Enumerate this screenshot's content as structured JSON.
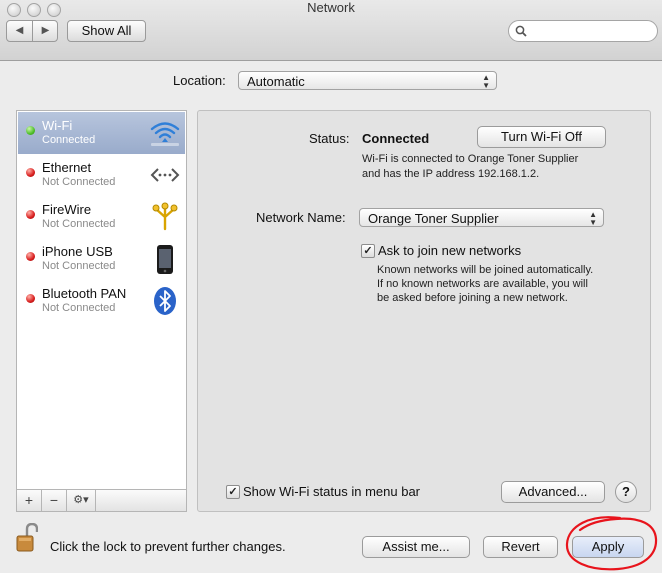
{
  "window": {
    "title": "Network"
  },
  "toolbar": {
    "show_all_label": "Show All",
    "back_icon": "chevron-left-icon",
    "forward_icon": "chevron-right-icon"
  },
  "location": {
    "label": "Location:",
    "value": "Automatic"
  },
  "services": [
    {
      "name": "Wi-Fi",
      "status": "Connected",
      "status_color": "#4fbf2a",
      "icon": "wifi-icon",
      "selected": true
    },
    {
      "name": "Ethernet",
      "status": "Not Connected",
      "status_color": "#d81e1e",
      "icon": "ethernet-icon",
      "selected": false
    },
    {
      "name": "FireWire",
      "status": "Not Connected",
      "status_color": "#d81e1e",
      "icon": "firewire-icon",
      "selected": false
    },
    {
      "name": "iPhone USB",
      "status": "Not Connected",
      "status_color": "#d81e1e",
      "icon": "iphone-icon",
      "selected": false
    },
    {
      "name": "Bluetooth PAN",
      "status": "Not Connected",
      "status_color": "#d81e1e",
      "icon": "bluetooth-icon",
      "selected": false
    }
  ],
  "sidebar_controls": {
    "add": "+",
    "remove": "−",
    "action": "⚙▾"
  },
  "detail": {
    "status_label": "Status:",
    "status_value": "Connected",
    "turn_off_label": "Turn Wi-Fi Off",
    "status_desc_1": "Wi-Fi is connected to Orange Toner Supplier",
    "status_desc_2": "and has the IP address 192.168.1.2.",
    "network_name_label": "Network Name:",
    "network_name_value": "Orange Toner Supplier",
    "ask_join_label": "Ask to join new networks",
    "ask_join_checked": true,
    "ask_join_desc_1": "Known networks will be joined automatically.",
    "ask_join_desc_2": "If no known networks are available, you will",
    "ask_join_desc_3": "be asked before joining a new network.",
    "show_status_label": "Show Wi-Fi status in menu bar",
    "show_status_checked": true,
    "advanced_label": "Advanced...",
    "help_label": "?"
  },
  "footer": {
    "lock_text": "Click the lock to prevent further changes.",
    "assist_label": "Assist me...",
    "revert_label": "Revert",
    "apply_label": "Apply",
    "highlight_color": "#e8141c"
  }
}
